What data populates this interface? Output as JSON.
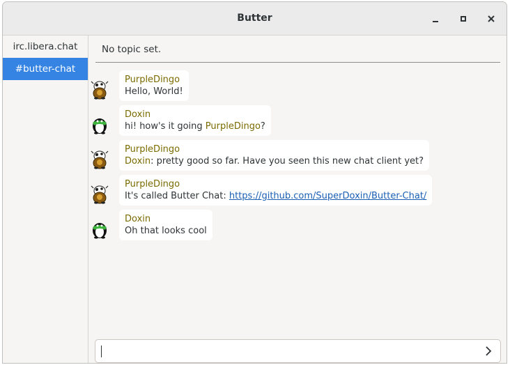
{
  "window": {
    "title": "Butter"
  },
  "sidebar": {
    "items": [
      {
        "label": "irc.libera.chat",
        "active": false
      },
      {
        "label": "#butter-chat",
        "active": true
      }
    ]
  },
  "channel": {
    "topic": "No topic set."
  },
  "messages": [
    {
      "nick": "PurpleDingo",
      "avatar": "cow-avatar-icon",
      "text": "Hello, World!"
    },
    {
      "nick": "Doxin",
      "avatar": "penguin-avatar-icon",
      "text_before": "hi! how's it going ",
      "mention": "PurpleDingo",
      "text_after": "?"
    },
    {
      "nick": "PurpleDingo",
      "avatar": "cow-avatar-icon",
      "mention": "Doxin",
      "text_after": ": pretty good so far. Have you seen this new chat client yet?"
    },
    {
      "nick": "PurpleDingo",
      "avatar": "cow-avatar-icon",
      "text_before": "It's called Butter Chat: ",
      "link": "https://github.com/SuperDoxin/Butter-Chat/"
    },
    {
      "nick": "Doxin",
      "avatar": "penguin-avatar-icon",
      "text": "Oh that looks cool"
    }
  ],
  "composer": {
    "value": "",
    "placeholder": ""
  },
  "colors": {
    "accent": "#3584e4",
    "nick": "#7a6b00",
    "link": "#1a5fb4"
  }
}
